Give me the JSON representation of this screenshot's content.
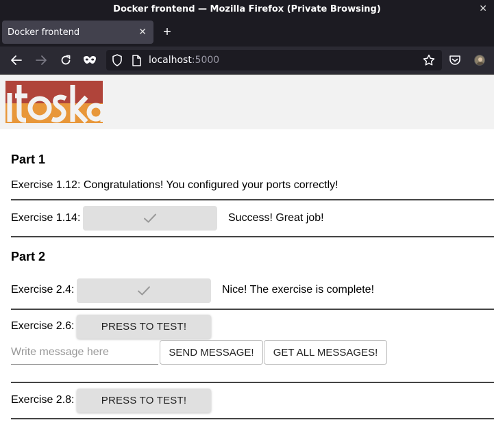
{
  "window": {
    "title": "Docker frontend — Mozilla Firefox (Private Browsing)",
    "close_glyph": "✕"
  },
  "tabs": [
    {
      "label": "Docker frontend",
      "close_glyph": "✕"
    }
  ],
  "newtab_glyph": "+",
  "navbar": {
    "url_host": "localhost",
    "url_port": ":5000",
    "icons": [
      "back-icon",
      "forward-icon",
      "reload-icon",
      "private-mask-icon",
      "shield-icon",
      "page-info-icon",
      "bookmark-star-icon",
      "pocket-icon",
      "account-avatar"
    ]
  },
  "logo": {
    "text": "itoska",
    "colors": {
      "top": "#b0443a",
      "bottom": "#e8973a"
    }
  },
  "part1": {
    "heading": "Part 1",
    "ex112": "Exercise 1.12: Congratulations! You configured your ports correctly!",
    "ex114_label": "Exercise 1.14:",
    "ex114_status": "Success! Great job!"
  },
  "part2": {
    "heading": "Part 2",
    "ex24_label": "Exercise 2.4:",
    "ex24_status": "Nice! The exercise is complete!",
    "ex26_label": "Exercise 2.6:",
    "ex26_button": "PRESS TO TEST!",
    "message_placeholder": "Write message here",
    "send_button": "SEND MESSAGE!",
    "get_all_button": "GET ALL MESSAGES!",
    "ex28_label": "Exercise 2.8:",
    "ex28_button": "PRESS TO TEST!"
  }
}
